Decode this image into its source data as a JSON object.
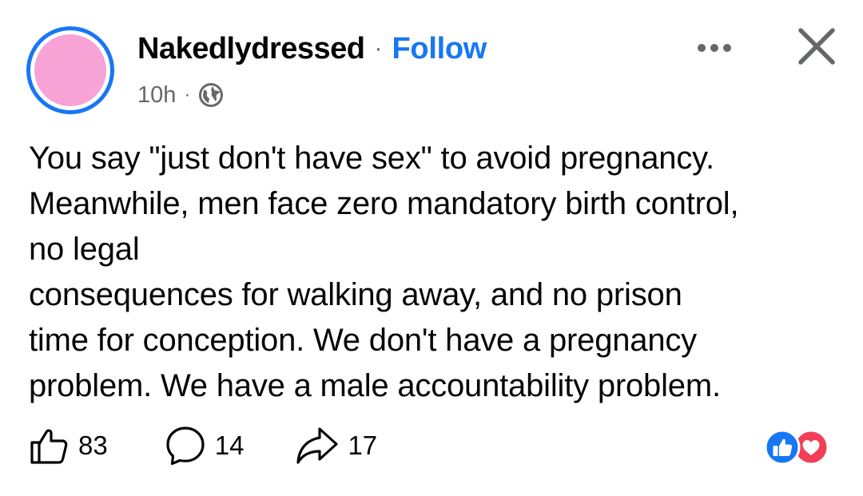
{
  "post": {
    "author": {
      "name": "Nakedlydressed",
      "separator": "·",
      "follow_label": "Follow",
      "avatar_color": "#f7a3d6",
      "avatar_ring_color": "#1877f2"
    },
    "meta": {
      "timestamp": "10h",
      "separator": "·",
      "audience_icon": "globe-icon"
    },
    "header_actions": {
      "more_icon": "more-horizontal-icon",
      "close_icon": "close-icon"
    },
    "text": "You say \"just don't have sex\" to avoid pregnancy.\nMeanwhile, men face zero mandatory birth control,\nno legal\nconsequences for walking away, and no prison\ntime for conception. We don't have a pregnancy\nproblem. We have a male accountability problem.",
    "actions": {
      "like": {
        "icon": "thumbs-up-icon",
        "count": "83"
      },
      "comment": {
        "icon": "comment-icon",
        "count": "14"
      },
      "share": {
        "icon": "share-icon",
        "count": "17"
      }
    },
    "reactions": [
      {
        "icon": "like-reaction-icon",
        "color": "#1877f2"
      },
      {
        "icon": "love-reaction-icon",
        "color": "#f33e58"
      }
    ]
  },
  "colors": {
    "text": "#050505",
    "secondary_text": "#65676b",
    "accent": "#1877f2"
  }
}
